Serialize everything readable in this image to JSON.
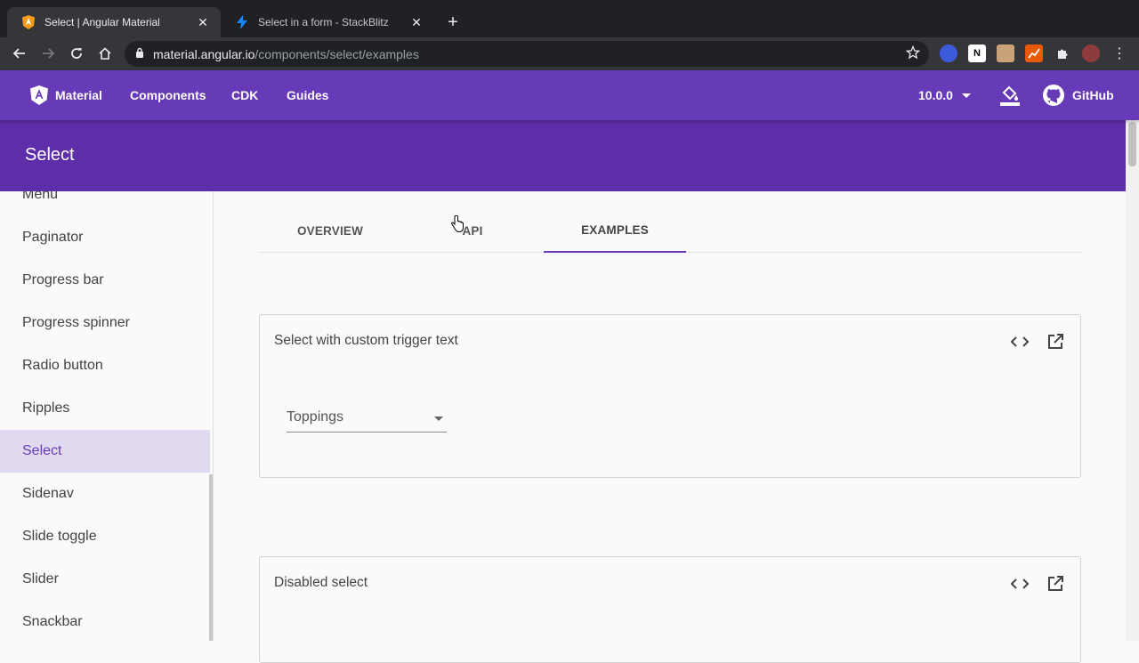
{
  "browser": {
    "tabs": [
      {
        "title": "Select | Angular Material",
        "favicon": "angular-shield-icon",
        "active": true
      },
      {
        "title": "Select in a form - StackBlitz",
        "favicon": "stackblitz-bolt-icon",
        "active": false
      }
    ],
    "new_tab": "+",
    "url_host": "material.angular.io",
    "url_path": "/components/select/examples"
  },
  "header": {
    "logo_label": "Material",
    "nav": [
      "Components",
      "CDK",
      "Guides"
    ],
    "version": "10.0.0",
    "github": "GitHub",
    "colors": {
      "primary": "#673ab7",
      "subheader": "#5e2ea8"
    }
  },
  "page_title": "Select",
  "sidebar": {
    "items": [
      {
        "label": "Menu",
        "selected": false
      },
      {
        "label": "Paginator",
        "selected": false
      },
      {
        "label": "Progress bar",
        "selected": false
      },
      {
        "label": "Progress spinner",
        "selected": false
      },
      {
        "label": "Radio button",
        "selected": false
      },
      {
        "label": "Ripples",
        "selected": false
      },
      {
        "label": "Select",
        "selected": true
      },
      {
        "label": "Sidenav",
        "selected": false
      },
      {
        "label": "Slide toggle",
        "selected": false
      },
      {
        "label": "Slider",
        "selected": false
      },
      {
        "label": "Snackbar",
        "selected": false
      }
    ]
  },
  "main": {
    "tabs": [
      {
        "label": "OVERVIEW",
        "active": false
      },
      {
        "label": "API",
        "active": false
      },
      {
        "label": "EXAMPLES",
        "active": true
      }
    ],
    "examples": [
      {
        "title": "Select with custom trigger text",
        "field_label": "Toppings"
      },
      {
        "title": "Disabled select"
      }
    ]
  }
}
